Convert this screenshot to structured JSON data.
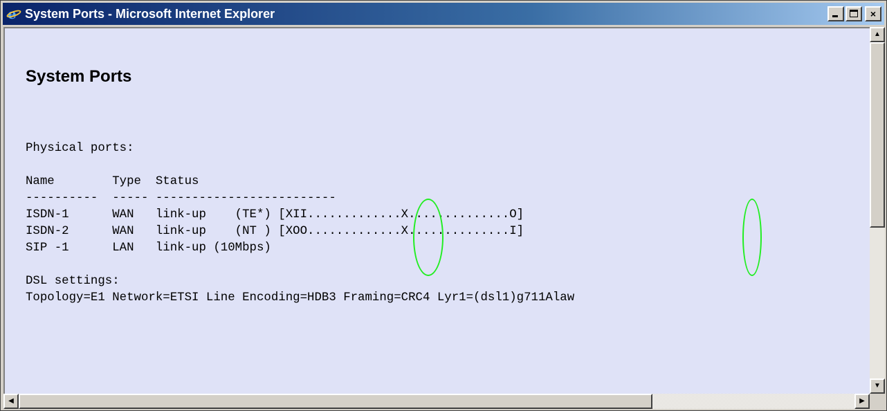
{
  "window": {
    "title": "System Ports - Microsoft Internet Explorer",
    "icon": "internet-explorer-icon",
    "controls": {
      "minimize": "minimize-icon",
      "maximize": "maximize-icon",
      "close": "×"
    }
  },
  "page": {
    "heading": "System Ports",
    "physical_ports_label": "Physical ports:",
    "table_header": "Name        Type  Status",
    "table_rule": "----------  ----- -------------------------",
    "rows": [
      "ISDN-1      WAN   link-up    (TE*) [XII.............X..............O]",
      "ISDN-2      WAN   link-up    (NT ) [XOO.............X..............I]",
      "SIP -1      LAN   link-up (10Mbps)"
    ],
    "dsl_label": "DSL settings:",
    "dsl_line": "Topology=E1 Network=ETSI Line Encoding=HDB3 Framing=CRC4 Lyr1=(dsl1)g711Alaw"
  },
  "scrollbars": {
    "up_arrow": "▲",
    "down_arrow": "▼",
    "left_arrow": "◀",
    "right_arrow": "▶"
  },
  "colors": {
    "content_bg": "#dfe2f7",
    "highlight_oval": "#22ee22",
    "titlebar_start": "#0a246a"
  }
}
